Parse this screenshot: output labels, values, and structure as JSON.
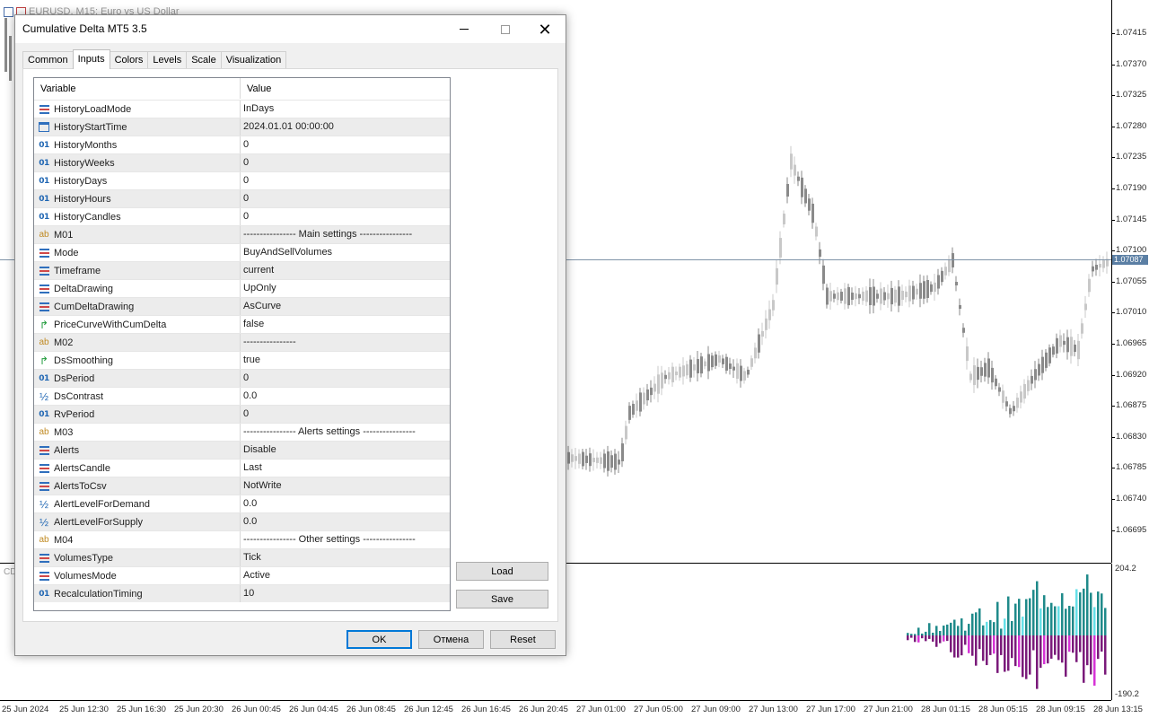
{
  "chart": {
    "title": "EURUSD, M15: Euro vs US Dollar",
    "price_ticks": [
      "1.07415",
      "1.07370",
      "1.07325",
      "1.07280",
      "1.07235",
      "1.07190",
      "1.07145",
      "1.07100",
      "1.07055",
      "1.07010",
      "1.06965",
      "1.06920",
      "1.06875",
      "1.06830",
      "1.06785",
      "1.06740",
      "1.06695"
    ],
    "current_price": "1.07087",
    "time_ticks": [
      "25 Jun 2024",
      "25 Jun 12:30",
      "25 Jun 16:30",
      "25 Jun 20:30",
      "26 Jun 00:45",
      "26 Jun 04:45",
      "26 Jun 08:45",
      "26 Jun 12:45",
      "26 Jun 16:45",
      "26 Jun 20:45",
      "27 Jun 01:00",
      "27 Jun 05:00",
      "27 Jun 09:00",
      "27 Jun 13:00",
      "27 Jun 17:00",
      "27 Jun 21:00",
      "28 Jun 01:15",
      "28 Jun 05:15",
      "28 Jun 09:15",
      "28 Jun 13:15"
    ],
    "indicator_label": "CD",
    "indicator_max": "204.2",
    "indicator_min": "-190.2",
    "colors": {
      "buy": "#1f8a8a",
      "buy_light": "#66e0e8",
      "sell": "#7a1a7a",
      "sell_light": "#d633d6",
      "candle": "#8a8a8a"
    }
  },
  "dialog": {
    "title": "Cumulative Delta MT5 3.5",
    "tabs": [
      "Common",
      "Inputs",
      "Colors",
      "Levels",
      "Scale",
      "Visualization"
    ],
    "active_tab": "Inputs",
    "columns": {
      "variable": "Variable",
      "value": "Value"
    },
    "rows": [
      {
        "icon": "enum",
        "name": "HistoryLoadMode",
        "value": "InDays"
      },
      {
        "icon": "datetime",
        "name": "HistoryStartTime",
        "value": "2024.01.01 00:00:00"
      },
      {
        "icon": "int",
        "name": "HistoryMonths",
        "value": "0"
      },
      {
        "icon": "int",
        "name": "HistoryWeeks",
        "value": "0"
      },
      {
        "icon": "int",
        "name": "HistoryDays",
        "value": "0"
      },
      {
        "icon": "int",
        "name": "HistoryHours",
        "value": "0"
      },
      {
        "icon": "int",
        "name": "HistoryCandles",
        "value": "0"
      },
      {
        "icon": "string",
        "name": "M01",
        "value": "---------------- Main settings ----------------"
      },
      {
        "icon": "enum",
        "name": "Mode",
        "value": "BuyAndSellVolumes"
      },
      {
        "icon": "enum",
        "name": "Timeframe",
        "value": "current"
      },
      {
        "icon": "enum",
        "name": "DeltaDrawing",
        "value": "UpOnly"
      },
      {
        "icon": "enum",
        "name": "CumDeltaDrawing",
        "value": "AsCurve"
      },
      {
        "icon": "bool",
        "name": "PriceCurveWithCumDelta",
        "value": "false"
      },
      {
        "icon": "string",
        "name": "M02",
        "value": "----------------"
      },
      {
        "icon": "bool",
        "name": "DsSmoothing",
        "value": "true"
      },
      {
        "icon": "int",
        "name": "DsPeriod",
        "value": "0"
      },
      {
        "icon": "double",
        "name": "DsContrast",
        "value": "0.0"
      },
      {
        "icon": "int",
        "name": "RvPeriod",
        "value": "0"
      },
      {
        "icon": "string",
        "name": "M03",
        "value": "---------------- Alerts settings ----------------"
      },
      {
        "icon": "enum",
        "name": "Alerts",
        "value": "Disable"
      },
      {
        "icon": "enum",
        "name": "AlertsCandle",
        "value": "Last"
      },
      {
        "icon": "enum",
        "name": "AlertsToCsv",
        "value": "NotWrite"
      },
      {
        "icon": "double",
        "name": "AlertLevelForDemand",
        "value": "0.0"
      },
      {
        "icon": "double",
        "name": "AlertLevelForSupply",
        "value": "0.0"
      },
      {
        "icon": "string",
        "name": "M04",
        "value": "---------------- Other settings ----------------"
      },
      {
        "icon": "enum",
        "name": "VolumesType",
        "value": "Tick"
      },
      {
        "icon": "enum",
        "name": "VolumesMode",
        "value": "Active"
      },
      {
        "icon": "int",
        "name": "RecalculationTiming",
        "value": "10"
      }
    ],
    "buttons": {
      "load": "Load",
      "save": "Save",
      "ok": "OK",
      "cancel": "Отмена",
      "reset": "Reset"
    }
  }
}
